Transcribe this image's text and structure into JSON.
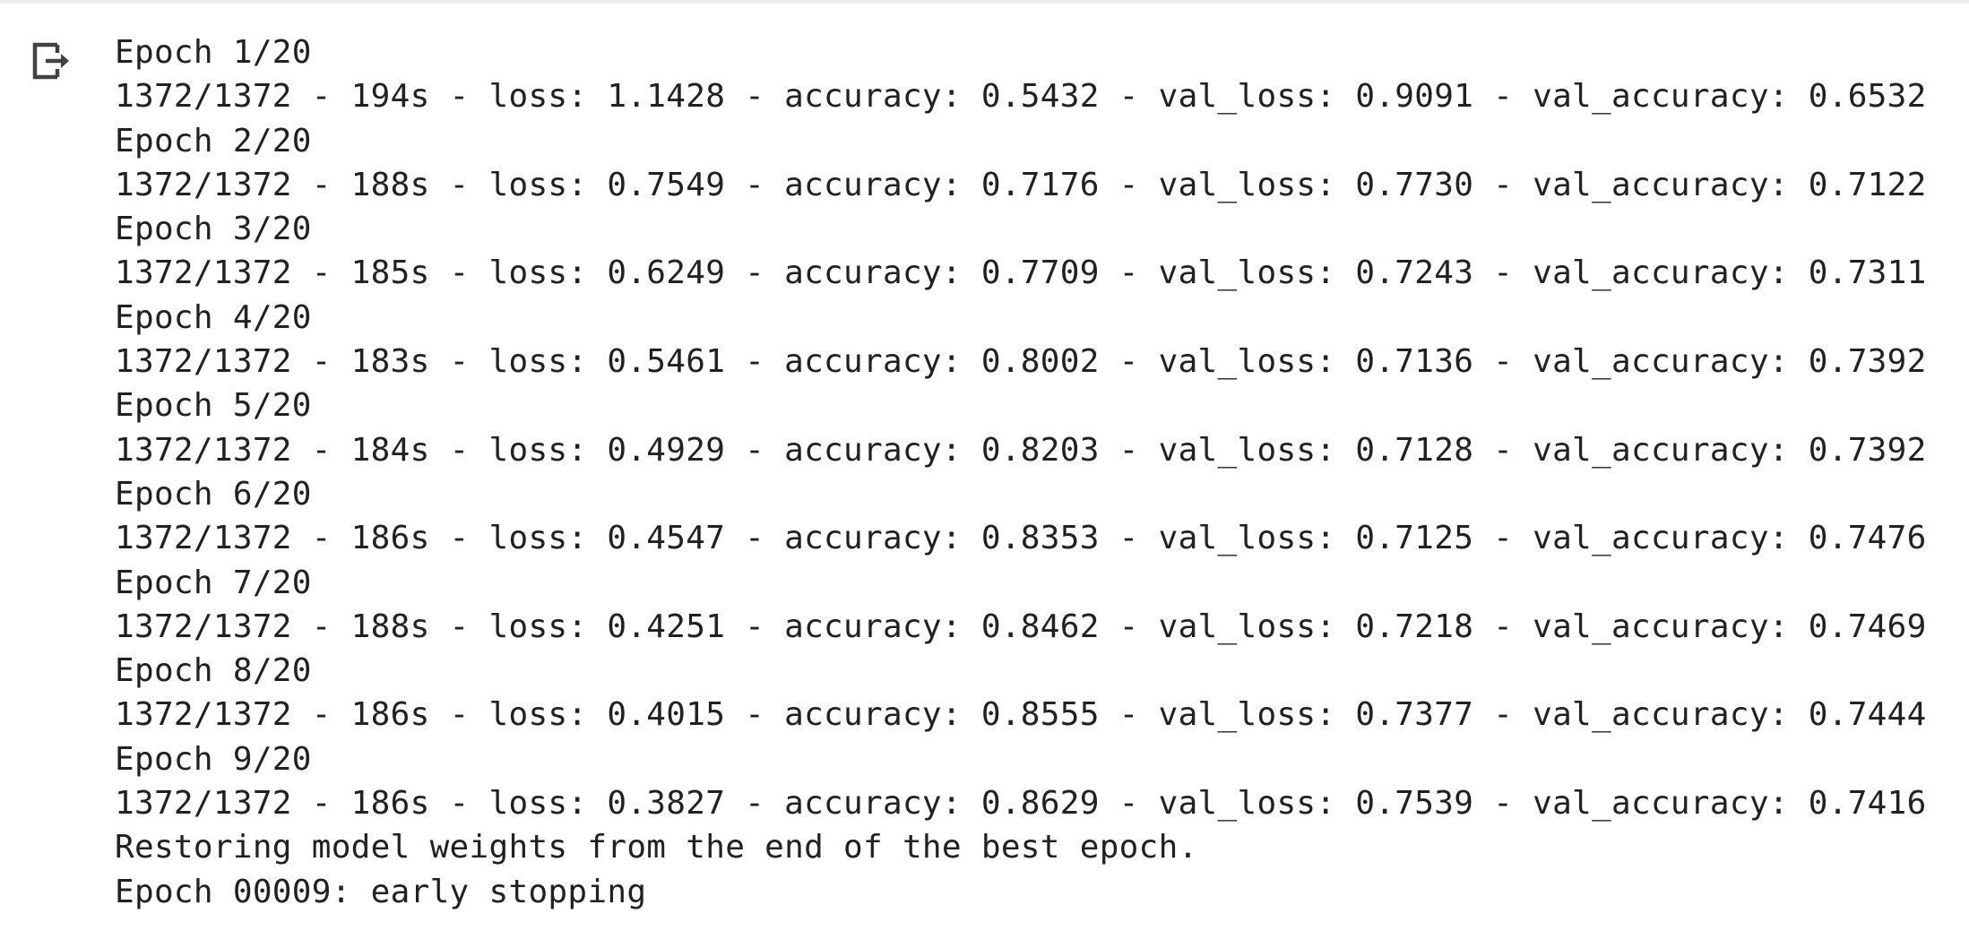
{
  "cell_output": {
    "icon": "output-redirect-icon",
    "lines": [
      "Epoch 1/20",
      "1372/1372 - 194s - loss: 1.1428 - accuracy: 0.5432 - val_loss: 0.9091 - val_accuracy: 0.6532",
      "Epoch 2/20",
      "1372/1372 - 188s - loss: 0.7549 - accuracy: 0.7176 - val_loss: 0.7730 - val_accuracy: 0.7122",
      "Epoch 3/20",
      "1372/1372 - 185s - loss: 0.6249 - accuracy: 0.7709 - val_loss: 0.7243 - val_accuracy: 0.7311",
      "Epoch 4/20",
      "1372/1372 - 183s - loss: 0.5461 - accuracy: 0.8002 - val_loss: 0.7136 - val_accuracy: 0.7392",
      "Epoch 5/20",
      "1372/1372 - 184s - loss: 0.4929 - accuracy: 0.8203 - val_loss: 0.7128 - val_accuracy: 0.7392",
      "Epoch 6/20",
      "1372/1372 - 186s - loss: 0.4547 - accuracy: 0.8353 - val_loss: 0.7125 - val_accuracy: 0.7476",
      "Epoch 7/20",
      "1372/1372 - 188s - loss: 0.4251 - accuracy: 0.8462 - val_loss: 0.7218 - val_accuracy: 0.7469",
      "Epoch 8/20",
      "1372/1372 - 186s - loss: 0.4015 - accuracy: 0.8555 - val_loss: 0.7377 - val_accuracy: 0.7444",
      "Epoch 9/20",
      "1372/1372 - 186s - loss: 0.3827 - accuracy: 0.8629 - val_loss: 0.7539 - val_accuracy: 0.7416",
      "Restoring model weights from the end of the best epoch.",
      "Epoch 00009: early stopping"
    ]
  },
  "colors": {
    "text": "#212121",
    "icon": "#424242",
    "background": "#ffffff"
  }
}
